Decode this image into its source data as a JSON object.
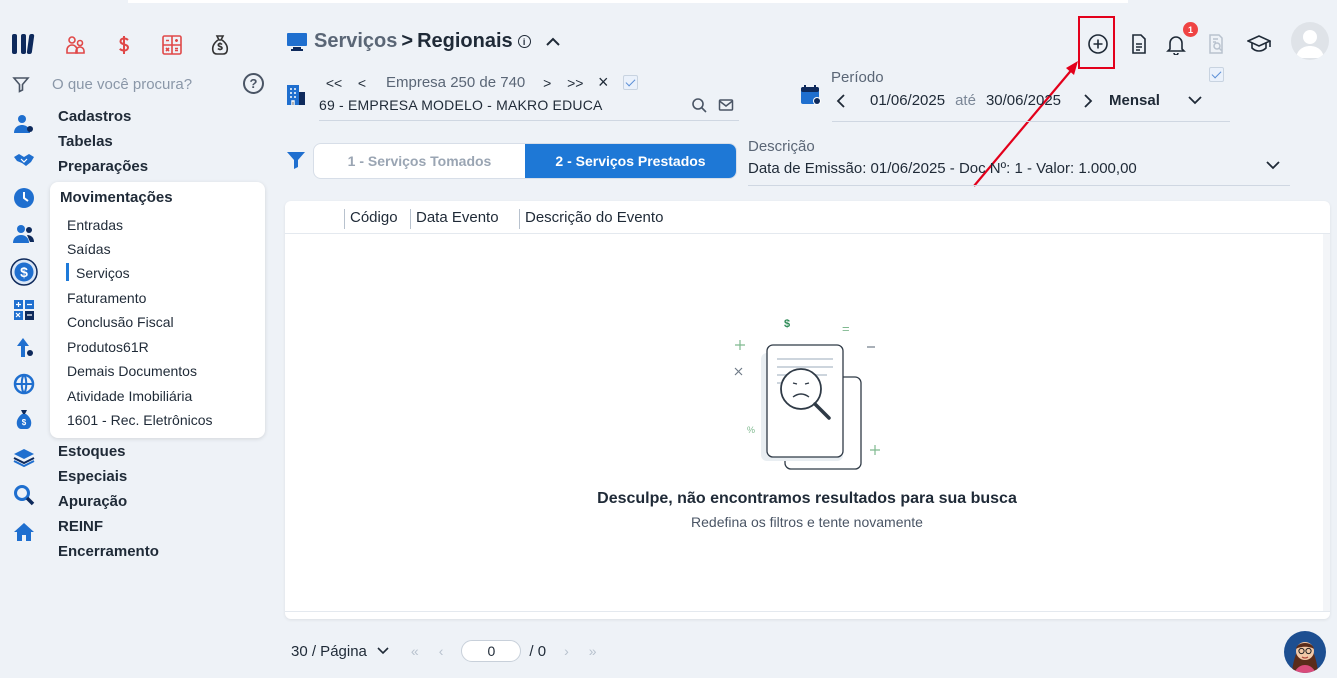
{
  "app": {
    "apps": [
      "people-icon",
      "dollar-icon",
      "calculator-icon",
      "money-bag-icon"
    ]
  },
  "search": {
    "placeholder": "O que você procura?",
    "help": "?"
  },
  "menu": {
    "top_items": [
      "Cadastros",
      "Tabelas",
      "Preparações"
    ],
    "section_title": "Movimentações",
    "sub_items": [
      "Entradas",
      "Saídas",
      "Serviços",
      "Faturamento",
      "Conclusão Fiscal",
      "Produtos61R",
      "Demais Documentos",
      "Atividade Imobiliária",
      "1601 - Rec. Eletrônicos"
    ],
    "active_sub": "Serviços",
    "bottom_items": [
      "Estoques",
      "Especiais",
      "Apuração",
      "REINF",
      "Encerramento"
    ]
  },
  "header": {
    "crumb1": "Serviços",
    "separator": ">",
    "crumb2": "Regionais",
    "info": "i",
    "notification_count": "1"
  },
  "empresa": {
    "label": "Empresa 250 de 740",
    "name": "69 - EMPRESA MODELO - MAKRO EDUCA",
    "first": "<<",
    "prev": "<",
    "next": ">",
    "last": ">>",
    "clear": "×"
  },
  "periodo": {
    "label": "Período",
    "from": "01/06/2025",
    "to_word": "até",
    "to": "30/06/2025",
    "frequency": "Mensal"
  },
  "tabs": {
    "items": [
      "1 - Serviços Tomados",
      "2 - Serviços Prestados"
    ],
    "active_index": 1
  },
  "descricao": {
    "label": "Descrição",
    "value": "Data de Emissão: 01/06/2025 - Doc Nº: 1 - Valor: 1.000,00"
  },
  "table": {
    "columns": [
      "Código",
      "Data Evento",
      "Descrição do Evento"
    ],
    "rows": []
  },
  "empty": {
    "title": "Desculpe, não encontramos resultados para sua busca",
    "subtitle": "Redefina os filtros e tente novamente"
  },
  "pagination": {
    "per_page": "30 / Página",
    "current": "0",
    "total": "/ 0"
  },
  "colors": {
    "accent": "#1e78d6",
    "highlight": "#e3001b",
    "badge": "#ef4444"
  }
}
